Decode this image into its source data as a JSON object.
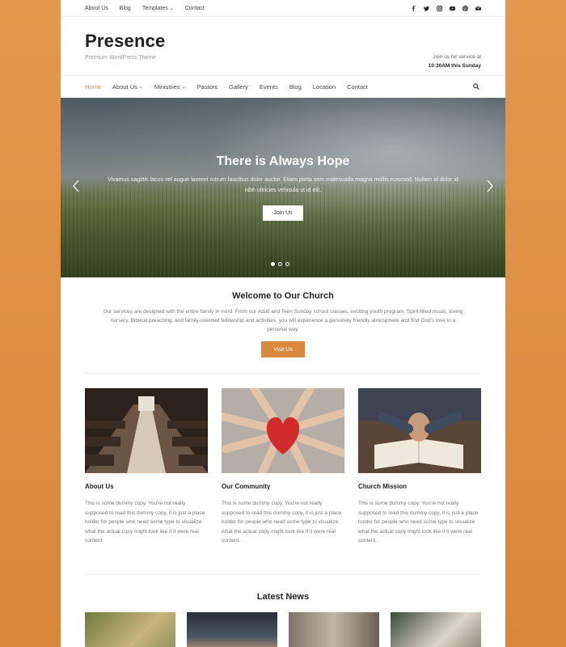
{
  "topbar": {
    "links": [
      "About Us",
      "Blog",
      "Templates",
      "Contact"
    ],
    "social_icons": [
      "facebook-icon",
      "twitter-icon",
      "instagram-icon",
      "youtube-icon",
      "pinterest-icon",
      "mail-icon"
    ]
  },
  "site": {
    "title": "Presence",
    "tagline": "Premium WordPress Theme",
    "service_line1": "Join us for service at",
    "service_line2": "10:30AM this Sunday"
  },
  "nav": {
    "items": [
      "Home",
      "About Us",
      "Ministries",
      "Pastors",
      "Gallery",
      "Events",
      "Blog",
      "Location",
      "Contact"
    ],
    "active": "Home"
  },
  "hero": {
    "title": "There is Always Hope",
    "text": "Vivamus sagittis lacus vel augue laoreet rutrum faucibus dolor auctor. Etiam porta sem malesuada magna mollis euismod. Nullam id dolor id nibh ultricies vehicula ut id elit.",
    "button": "Join Us",
    "slides": 3,
    "active_slide": 1
  },
  "welcome": {
    "title": "Welcome to Our Church",
    "text": "Our services are designed with the entire family in mind. From our Adult and Teen Sunday school classes, exciting youth program, Spirit-filled music, loving nursery, Biblical preaching, and family-oriented fellowship and activities, you will experience a genuinely friendly atmosphere and find God's love in a personal way.",
    "button": "Visit Us"
  },
  "features": [
    {
      "title": "About Us",
      "text": "This is some dummy copy. You're not really supposed to read this dummy copy, it is just a place holder for people who need some type to visualize what the actual copy might look like if it were real content."
    },
    {
      "title": "Our Community",
      "text": "This is some dummy copy. You're not really supposed to read this dummy copy, it is just a place holder for people who need some type to visualize what the actual copy might look like if it were real content."
    },
    {
      "title": "Church Mission",
      "text": "This is some dummy copy. You're not really supposed to read this dummy copy, it is just a place holder for people who need some type to visualize what the actual copy might look like if it were real content."
    }
  ],
  "latest_news": {
    "title": "Latest News"
  },
  "colors": {
    "accent": "#d9883e",
    "page_background": "#e0923f"
  }
}
